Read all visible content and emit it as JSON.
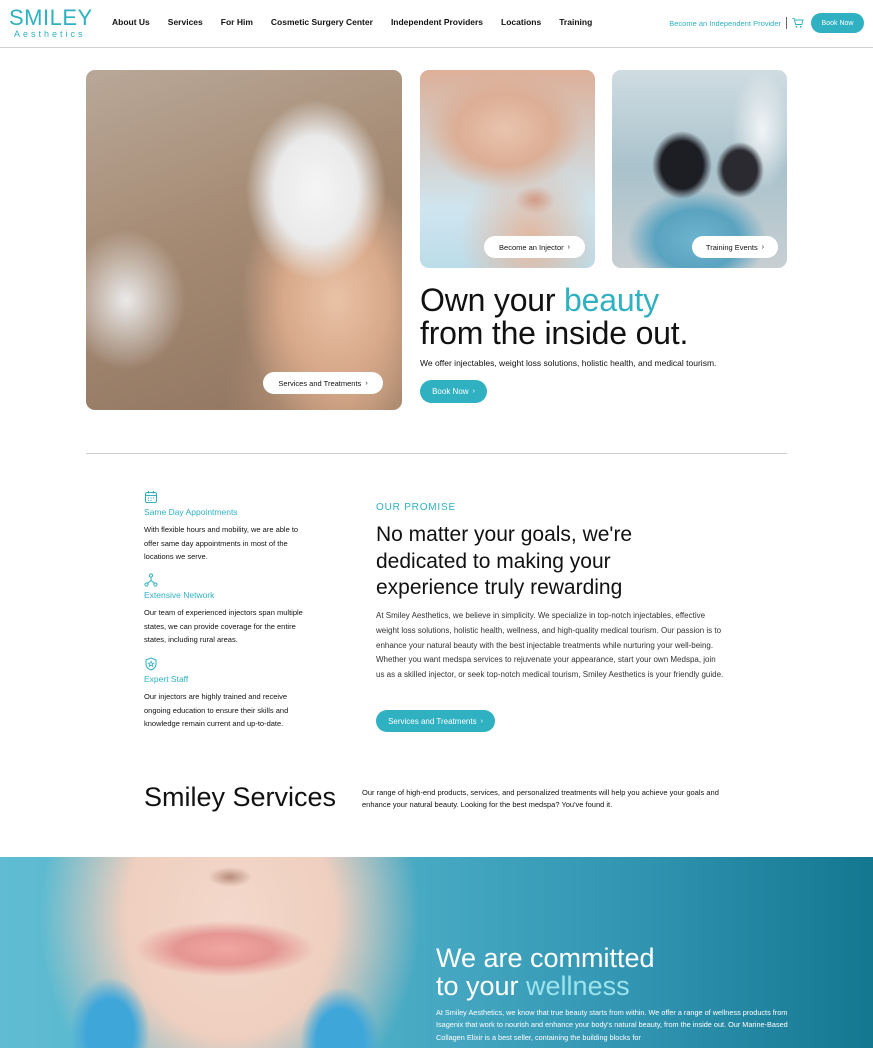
{
  "header": {
    "logo_top": "SMILEY",
    "logo_bottom": "Aesthetics",
    "nav": [
      "About Us",
      "Services",
      "For Him",
      "Cosmetic Surgery Center",
      "Independent Providers",
      "Locations",
      "Training"
    ],
    "indie_link": "Become an Independent Provider",
    "book_label": "Book Now"
  },
  "hero": {
    "main_button": "Services and Treatments",
    "injector_button": "Become an Injector",
    "training_button": "Training Events",
    "title_part1": "Own your ",
    "title_accent": "beauty",
    "title_line2": "from the inside out.",
    "subtitle": "We offer injectables, weight loss solutions, holistic health, and medical tourism.",
    "book_label": "Book Now"
  },
  "features": [
    {
      "icon": "calendar-icon",
      "title": "Same Day Appointments",
      "text": "With flexible hours and mobility, we are able to offer same day appointments in most of the locations we serve."
    },
    {
      "icon": "network-icon",
      "title": "Extensive Network",
      "text": "Our team of experienced injectors span multiple states, we can provide coverage for the entire states, including rural areas."
    },
    {
      "icon": "shield-star-icon",
      "title": "Expert Staff",
      "text": "Our injectors are highly trained and receive ongoing education to ensure their skills and knowledge remain current and up-to-date."
    }
  ],
  "promise": {
    "label": "OUR PROMISE",
    "title": "No matter your goals, we're dedicated to making your experience truly rewarding",
    "text": "At Smiley Aesthetics, we believe in simplicity. We specialize in top-notch injectables, effective weight loss solutions, holistic health, wellness, and high-quality medical tourism. Our passion is to enhance your natural beauty with the best injectable treatments while nurturing your well-being. Whether you want medspa services to rejuvenate your appearance, start your own Medspa, join us as a skilled injector, or seek top-notch medical tourism, Smiley Aesthetics is your friendly guide.",
    "button": "Services and Treatments"
  },
  "services": {
    "title": "Smiley Services",
    "text": "Our range of high-end products, services, and personalized treatments will help you achieve your goals and enhance your natural beauty. Looking for the best medspa? You've found it."
  },
  "wellness": {
    "title_line1": "We are committed",
    "title_line2_part1": "to your ",
    "title_accent": "wellness",
    "text": "At Smiley Aesthetics, we know that true beauty starts from within. We offer a range of wellness products from Isagenix that work to nourish and enhance your body's natural beauty, from the inside out. Our Marine-Based Collagen Elixir is a best seller, containing the building blocks for"
  },
  "colors": {
    "accent": "#2fb1c2",
    "band_dark": "#137790"
  }
}
